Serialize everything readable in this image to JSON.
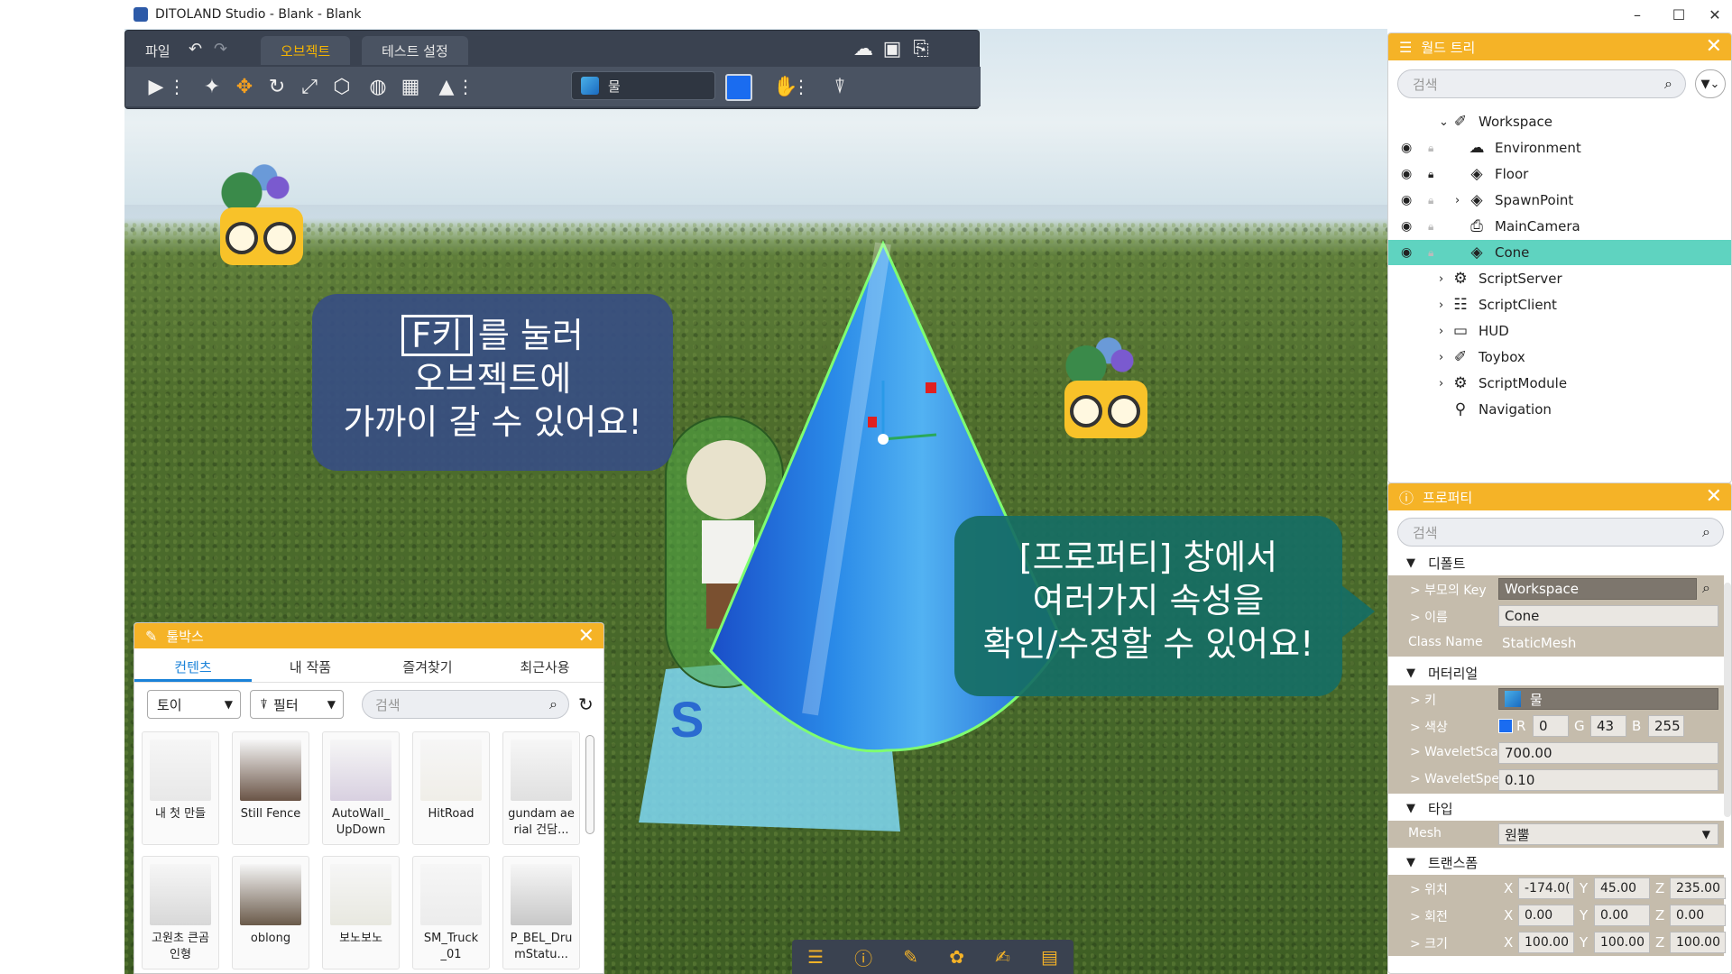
{
  "window": {
    "title": "DITOLAND Studio - Blank - Blank",
    "controls": [
      "–",
      "☐",
      "✕"
    ]
  },
  "top_toolbar": {
    "file_menu": "파일",
    "tabs": [
      "오브젝트",
      "테스트 설정"
    ],
    "active_tab": "오브젝트",
    "material_name": "물",
    "material_color": "#1a6cf0"
  },
  "bubbles": {
    "left": {
      "key": "F키",
      "line1": "를 눌러",
      "line2": "오브젝트에",
      "line3": "가까이 갈 수 있어요!"
    },
    "right": {
      "line1": "[프로퍼티] 창에서",
      "line2": "여러가지 속성을",
      "line3": "확인/수정할 수 있어요!"
    }
  },
  "toolbox": {
    "title": "툴박스",
    "tabs": [
      "컨텐츠",
      "내 작품",
      "즐겨찾기",
      "최근사용"
    ],
    "active_tab": "컨텐츠",
    "category": "토이",
    "filter_label": "필터",
    "search_placeholder": "검색",
    "items": [
      "내 첫 만들",
      "Still Fence",
      "AutoWall_\nUpDown",
      "HitRoad",
      "gundam ae\nrial 건담...",
      "고원초 큰곰\n인형",
      "oblong",
      "보노보노",
      "SM_Truck\n_01",
      "P_BEL_Dru\nmStatu..."
    ]
  },
  "world_tree": {
    "title": "월드 트리",
    "search_placeholder": "검색",
    "items": [
      {
        "label": "Workspace",
        "icon": "workspace-icon"
      },
      {
        "label": "Environment",
        "icon": "environment-icon"
      },
      {
        "label": "Floor",
        "icon": "cube-icon"
      },
      {
        "label": "SpawnPoint",
        "icon": "cube-icon"
      },
      {
        "label": "MainCamera",
        "icon": "camera-icon"
      },
      {
        "label": "Cone",
        "icon": "cube-icon"
      },
      {
        "label": "ScriptServer",
        "icon": "script-server-icon"
      },
      {
        "label": "ScriptClient",
        "icon": "script-client-icon"
      },
      {
        "label": "HUD",
        "icon": "hud-icon"
      },
      {
        "label": "Toybox",
        "icon": "toybox-icon"
      },
      {
        "label": "ScriptModule",
        "icon": "script-module-icon"
      },
      {
        "label": "Navigation",
        "icon": "navigation-pin-icon"
      }
    ]
  },
  "properties": {
    "title": "프로퍼티",
    "search_placeholder": "검색",
    "sections": {
      "default": "디폴트",
      "material": "머터리얼",
      "type": "타입",
      "transform": "트랜스폼"
    },
    "parent_key_label": "> 부모의 Key",
    "parent_key_value": "Workspace",
    "name_label": "> 이름",
    "name_value": "Cone",
    "class_name_label": "Class Name",
    "class_name_value": "StaticMesh",
    "mat_key_label": "> 키",
    "mat_key_value": "물",
    "color_label": "> 색상",
    "color": {
      "r": "0",
      "g": "43",
      "b": "255",
      "r_lbl": "R",
      "g_lbl": "G",
      "b_lbl": "B"
    },
    "wavelet_scale_label": "> WaveletSca",
    "wavelet_scale_value": "700.00",
    "wavelet_speed_label": "> WaveletSpe",
    "wavelet_speed_value": "0.10",
    "mesh_label": "Mesh",
    "mesh_value": "원뿔",
    "position_label": "> 위치",
    "position": {
      "x": "-174.0(",
      "y": "45.00",
      "z": "235.00"
    },
    "rotation_label": "> 회전",
    "rotation": {
      "x": "0.00",
      "y": "0.00",
      "z": "0.00"
    },
    "scale_label": "> 크기",
    "scale": {
      "x": "100.00",
      "y": "100.00",
      "z": "100.00"
    },
    "axis": {
      "x": "X",
      "y": "Y",
      "z": "Z"
    }
  }
}
